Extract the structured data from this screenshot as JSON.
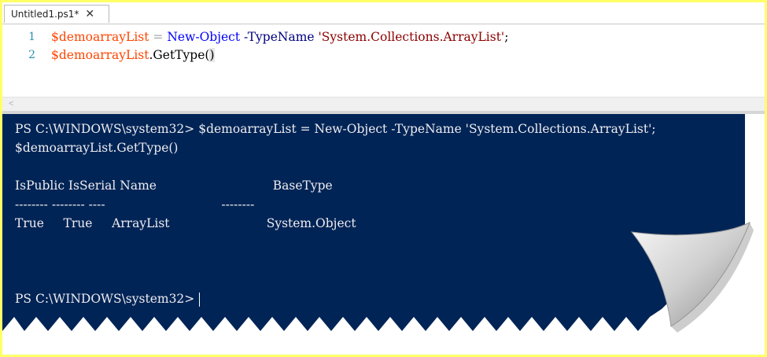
{
  "tab": {
    "title": "Untitled1.ps1*",
    "close_glyph": "✕",
    "close_icon": "close-icon"
  },
  "editor": {
    "lines": [
      {
        "number": "1",
        "tokens": [
          {
            "text": "$demoarrayList",
            "type": "var"
          },
          {
            "text": " = ",
            "type": "op"
          },
          {
            "text": "New-Object",
            "type": "cmd"
          },
          {
            "text": " ",
            "type": "plain"
          },
          {
            "text": "-TypeName",
            "type": "param"
          },
          {
            "text": " ",
            "type": "plain"
          },
          {
            "text": "'System.Collections.ArrayList'",
            "type": "str"
          },
          {
            "text": ";",
            "type": "plain"
          }
        ]
      },
      {
        "number": "2",
        "tokens": [
          {
            "text": "$demoarrayList",
            "type": "var"
          },
          {
            "text": ".GetType(",
            "type": "plain"
          },
          {
            "text": ")",
            "type": "plain"
          }
        ]
      }
    ],
    "hscroll_arrow": "<"
  },
  "console": {
    "lines": [
      "PS C:\\WINDOWS\\system32> $demoarrayList = New-Object -TypeName 'System.Collections.ArrayList';",
      "$demoarrayList.GetType()",
      "",
      "IsPublic IsSerial Name                              BaseType",
      "-------- -------- ----                              --------",
      "True     True     ArrayList                         System.Object",
      "",
      "",
      "",
      "PS C:\\WINDOWS\\system32>"
    ]
  },
  "colors": {
    "console_bg": "#012456",
    "console_fg": "#eeedf0",
    "background_highlight": "#ffff66",
    "variable": "#ff4500",
    "cmdlet": "#0000ff",
    "parameter": "#000080",
    "string": "#8b0000"
  }
}
